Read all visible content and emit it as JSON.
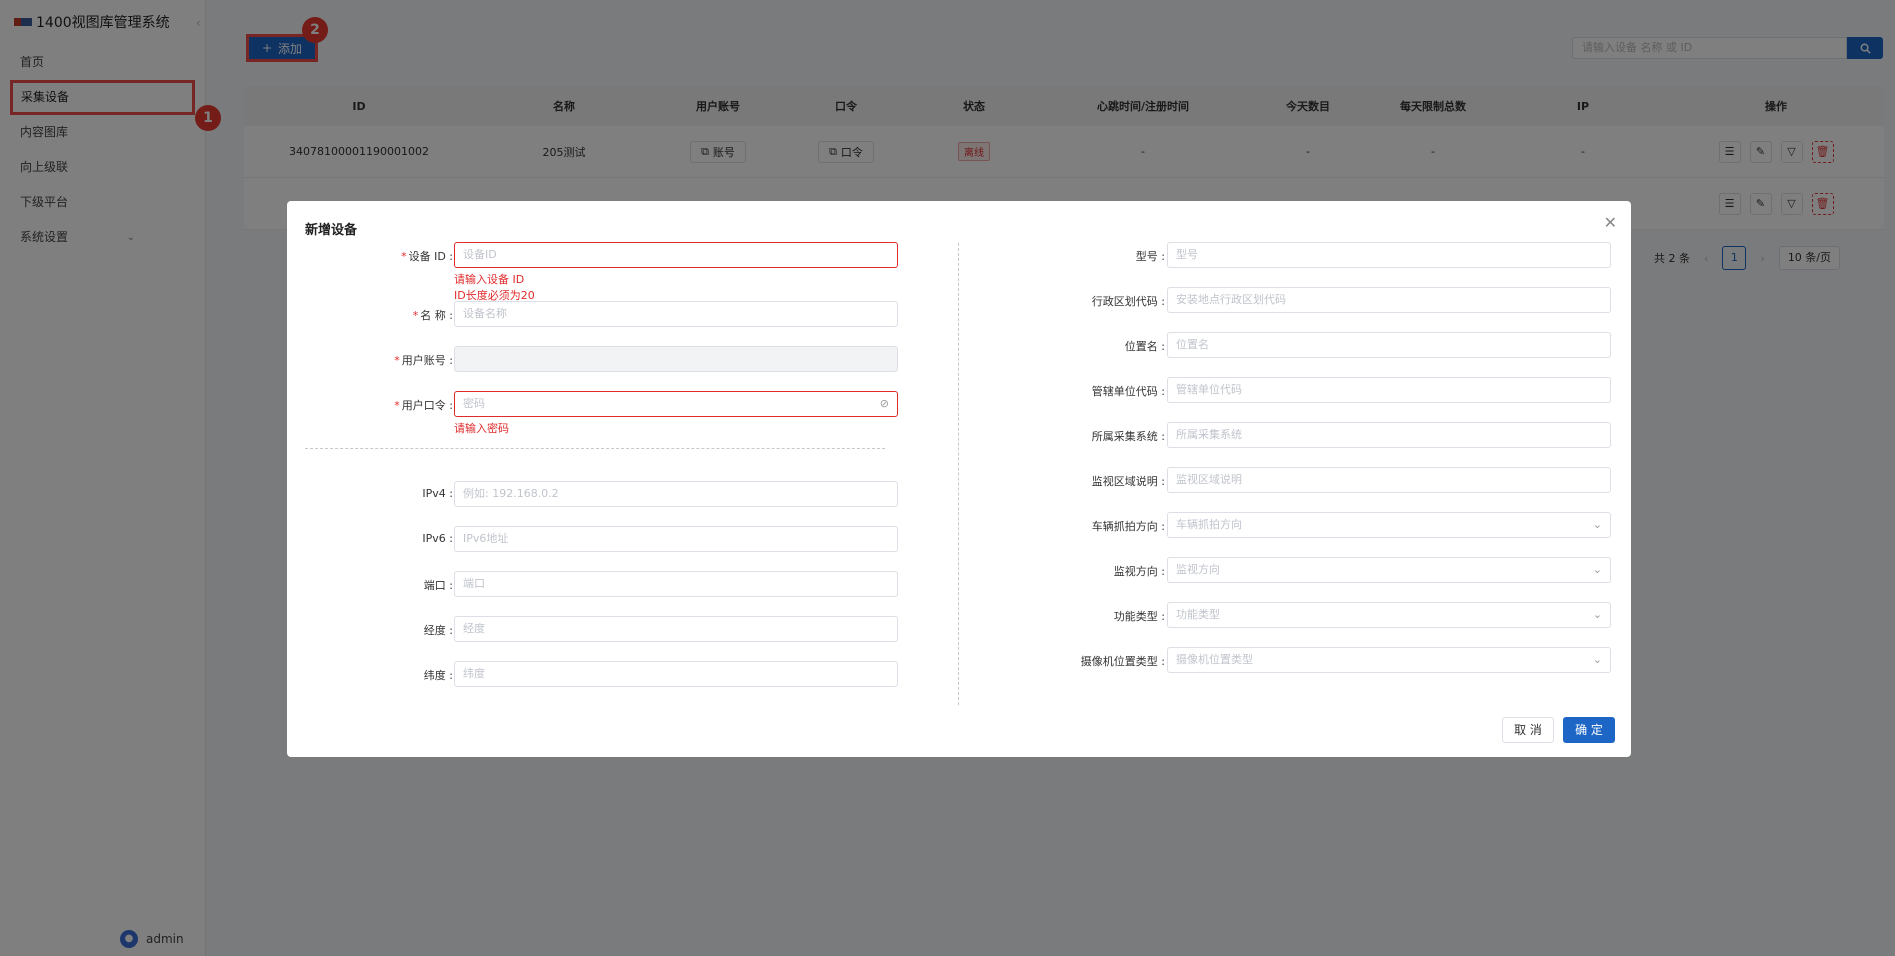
{
  "app": {
    "title": "1400视图库管理系统"
  },
  "sidebar": {
    "items": [
      {
        "label": "首页"
      },
      {
        "label": "采集设备"
      },
      {
        "label": "内容图库"
      },
      {
        "label": "向上级联"
      },
      {
        "label": "下级平台"
      },
      {
        "label": "系统设置"
      }
    ],
    "user": "admin"
  },
  "annotations": {
    "badge1": "1",
    "badge2": "2"
  },
  "toolbar": {
    "add_label": "添加",
    "search_placeholder": "请输入设备 名称 或 ID"
  },
  "table": {
    "headers": [
      "ID",
      "名称",
      "用户账号",
      "口令",
      "状态",
      "心跳时间/注册时间",
      "今天数目",
      "每天限制总数",
      "IP",
      "操作"
    ],
    "rows": [
      {
        "id": "34078100001190001002",
        "name": "205测试",
        "account": "账号",
        "password": "口令",
        "status": "离线",
        "heartbeat": "-",
        "today": "-",
        "limit": "-",
        "ip": "-"
      },
      {
        "id": "",
        "name": "",
        "account": "",
        "password": "",
        "status": "",
        "heartbeat": "",
        "today": "",
        "limit": "",
        "ip": ""
      }
    ]
  },
  "pagination": {
    "total": "共 2 条",
    "current": "1",
    "page_size": "10 条/页"
  },
  "dialog": {
    "title": "新增设备",
    "left": {
      "device_id": {
        "label": "设备 ID :",
        "placeholder": "设备ID",
        "error1": "请输入设备 ID",
        "error2": "ID长度必须为20"
      },
      "name": {
        "label": "名 称 :",
        "placeholder": "设备名称"
      },
      "account": {
        "label": "用户账号 :",
        "placeholder": ""
      },
      "password": {
        "label": "用户口令 :",
        "placeholder": "密码",
        "error": "请输入密码"
      },
      "ipv4": {
        "label": "IPv4 :",
        "placeholder": "例如: 192.168.0.2"
      },
      "ipv6": {
        "label": "IPv6 :",
        "placeholder": "IPv6地址"
      },
      "port": {
        "label": "端口 :",
        "placeholder": "端口"
      },
      "longitude": {
        "label": "经度 :",
        "placeholder": "经度"
      },
      "latitude": {
        "label": "纬度 :",
        "placeholder": "纬度"
      }
    },
    "right": {
      "model": {
        "label": "型号 :",
        "placeholder": "型号"
      },
      "region_code": {
        "label": "行政区划代码 :",
        "placeholder": "安装地点行政区划代码"
      },
      "location": {
        "label": "位置名 :",
        "placeholder": "位置名"
      },
      "org_code": {
        "label": "管辖单位代码 :",
        "placeholder": "管辖单位代码"
      },
      "system": {
        "label": "所属采集系统 :",
        "placeholder": "所属采集系统"
      },
      "area_desc": {
        "label": "监视区域说明 :",
        "placeholder": "监视区域说明"
      },
      "capture_dir": {
        "label": "车辆抓拍方向 :",
        "placeholder": "车辆抓拍方向"
      },
      "monitor_dir": {
        "label": "监视方向 :",
        "placeholder": "监视方向"
      },
      "func_type": {
        "label": "功能类型 :",
        "placeholder": "功能类型"
      },
      "position_type": {
        "label": "摄像机位置类型 :",
        "placeholder": "摄像机位置类型"
      }
    },
    "cancel_label": "取 消",
    "ok_label": "确 定"
  },
  "colors": {
    "primary": "#1d66c6",
    "danger": "#e02b2b",
    "highlight": "#f04a4a"
  }
}
